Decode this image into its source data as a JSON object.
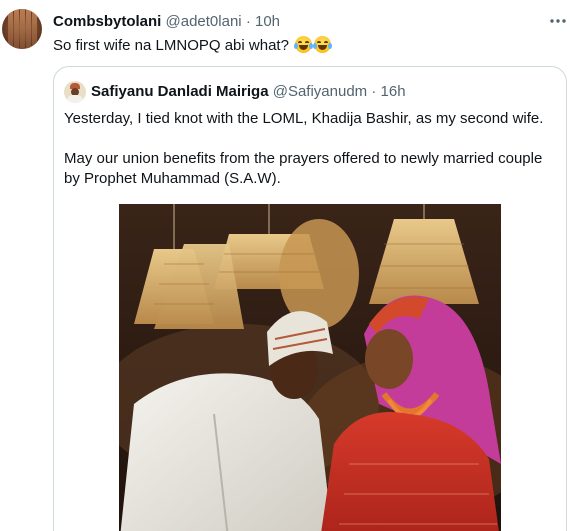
{
  "tweet": {
    "author_name": "Combsbytolani",
    "handle": "@adet0lani",
    "separator": "·",
    "time": "10h",
    "text": "So first wife na LMNOPQ abi what?",
    "emojis": [
      "face-with-tears-of-joy",
      "face-with-tears-of-joy"
    ],
    "more_icon": "more-horizontal-icon"
  },
  "quoted_tweet": {
    "author_name": "Safiyanu Danladi Mairiga",
    "handle": "@Safiyanudm",
    "separator": "·",
    "time": "16h",
    "paragraph_1": "Yesterday, I tied knot with the LOML, Khadija Bashir, as my second wife.",
    "paragraph_2": "May our union benefits from the prayers offered to newly married couple by Prophet Muhammad (S.A.W).",
    "image_icon": "wedding-photo"
  }
}
